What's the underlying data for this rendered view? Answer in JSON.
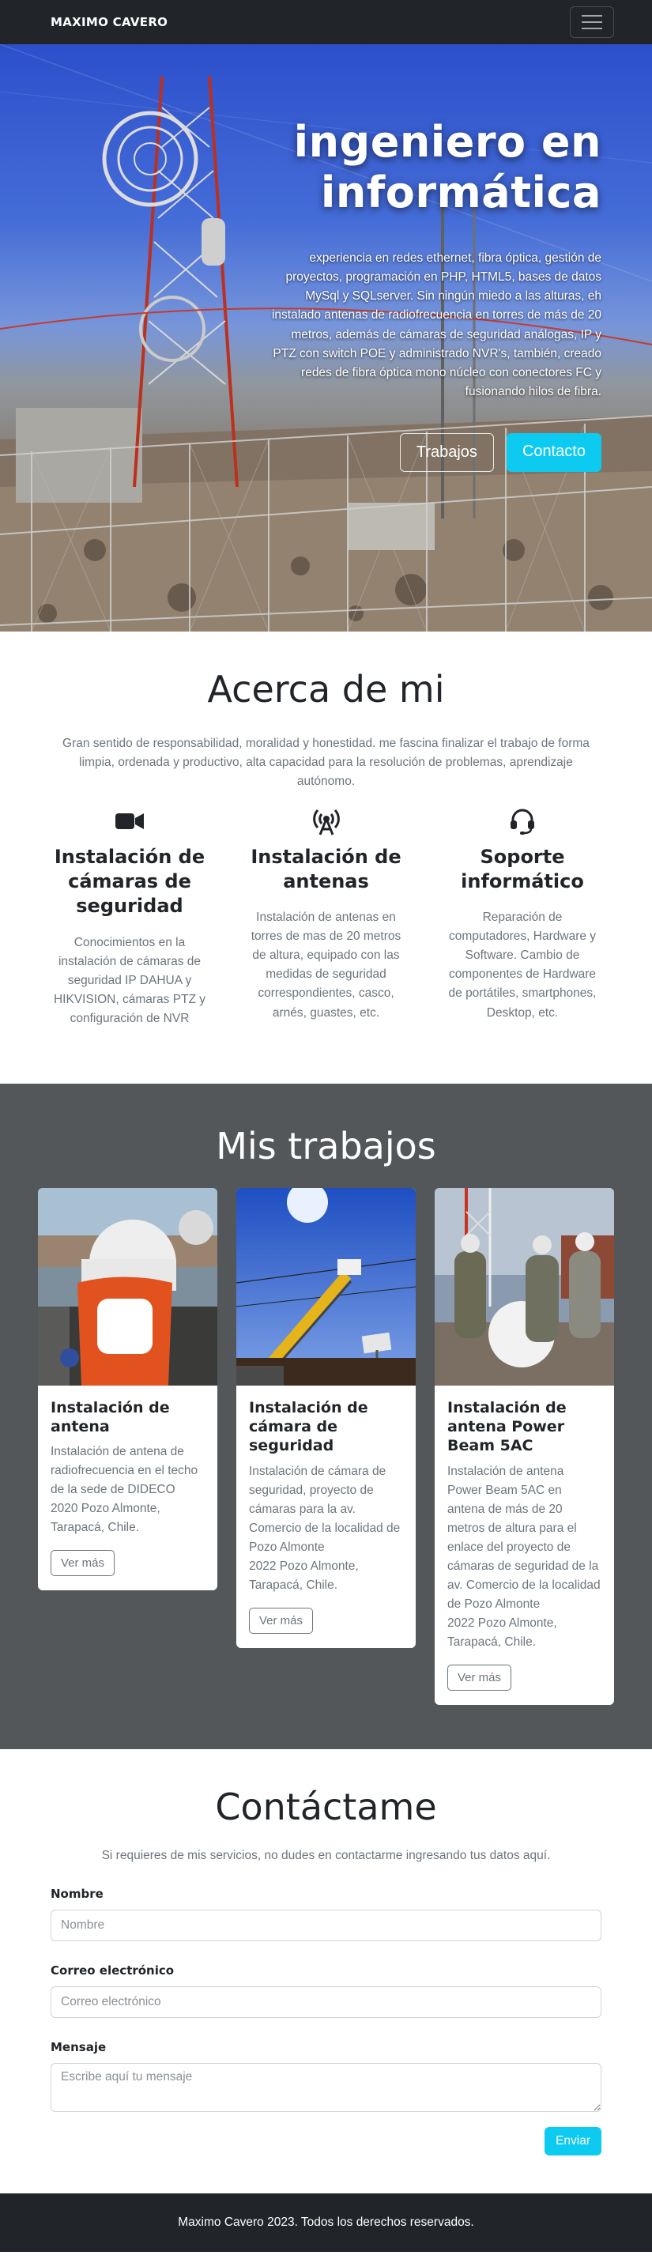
{
  "navbar": {
    "brand": "MAXIMO CAVERO"
  },
  "hero": {
    "title": "ingeniero en informática",
    "text": "experiencia en redes ethernet, fibra óptica, gestión de proyectos, programación en PHP, HTML5, bases de datos MySql y SQLserver. Sin ningún miedo a las alturas, eh instalado antenas de radiofrecuencia en torres de más de 20 metros, además de cámaras de seguridad análogas, IP y PTZ con switch POE y administrado NVR's, también, creado redes de fibra óptica mono núcleo con conectores FC y fusionando hilos de fibra.",
    "btn_trabajos": "Trabajos",
    "btn_contacto": "Contacto"
  },
  "about": {
    "title": "Acerca de mi",
    "text": "Gran sentido de responsabilidad, moralidad y honestidad. me fascina finalizar el trabajo de forma limpia, ordenada y productivo, alta capacidad para la resolución de problemas, aprendizaje autónomo.",
    "features": [
      {
        "icon": "video-camera-icon",
        "title": "Instalación de cámaras de seguridad",
        "text": "Conocimientos en la instalación de cámaras de seguridad IP DAHUA y HIKVISION, cámaras PTZ y configuración de NVR"
      },
      {
        "icon": "broadcast-antenna-icon",
        "title": "Instalación de antenas",
        "text": "Instalación de antenas en torres de mas de 20 metros de altura, equipado con las medidas de seguridad correspondientes, casco, arnés, guastes, etc."
      },
      {
        "icon": "headset-icon",
        "title": "Soporte informático",
        "text": "Reparación de computadores, Hardware y Software. Cambio de componentes de Hardware de portátiles, smartphones, Desktop, etc."
      }
    ]
  },
  "works": {
    "title": "Mis trabajos",
    "cards": [
      {
        "title": "Instalación de antena",
        "text": "Instalación de antena de radiofrecuencia en el techo de la sede de DIDECO\n2020 Pozo Almonte, Tarapacá, Chile.",
        "button": "Ver más"
      },
      {
        "title": "Instalación de cámara de seguridad",
        "text": "Instalación de cámara de seguridad, proyecto de cámaras para la av. Comercio de la localidad de Pozo Almonte\n2022 Pozo Almonte, Tarapacá, Chile.",
        "button": "Ver más"
      },
      {
        "title": "Instalación de antena Power Beam 5AC",
        "text": "Instalación de antena Power Beam 5AC en antena de más de 20 metros de altura para el enlace del proyecto de cámaras de seguridad de la av. Comercio de la localidad de Pozo Almonte\n2022 Pozo Almonte, Tarapacá, Chile.",
        "button": "Ver más"
      }
    ]
  },
  "contact": {
    "title": "Contáctame",
    "text": "Si requieres de mis servicios, no dudes en contactarme ingresando tus datos aquí.",
    "name_label": "Nombre",
    "name_placeholder": "Nombre",
    "email_label": "Correo electrónico",
    "email_placeholder": "Correo electrónico",
    "message_label": "Mensaje",
    "message_placeholder": "Escribe aquí tu mensaje",
    "submit": "Enviar"
  },
  "footer": {
    "text": "Maximo Cavero 2023. Todos los derechos reservados."
  },
  "colors": {
    "accent": "#0dcaf0",
    "dark": "#212529",
    "works_bg": "#53575a",
    "muted": "#6c757d"
  }
}
